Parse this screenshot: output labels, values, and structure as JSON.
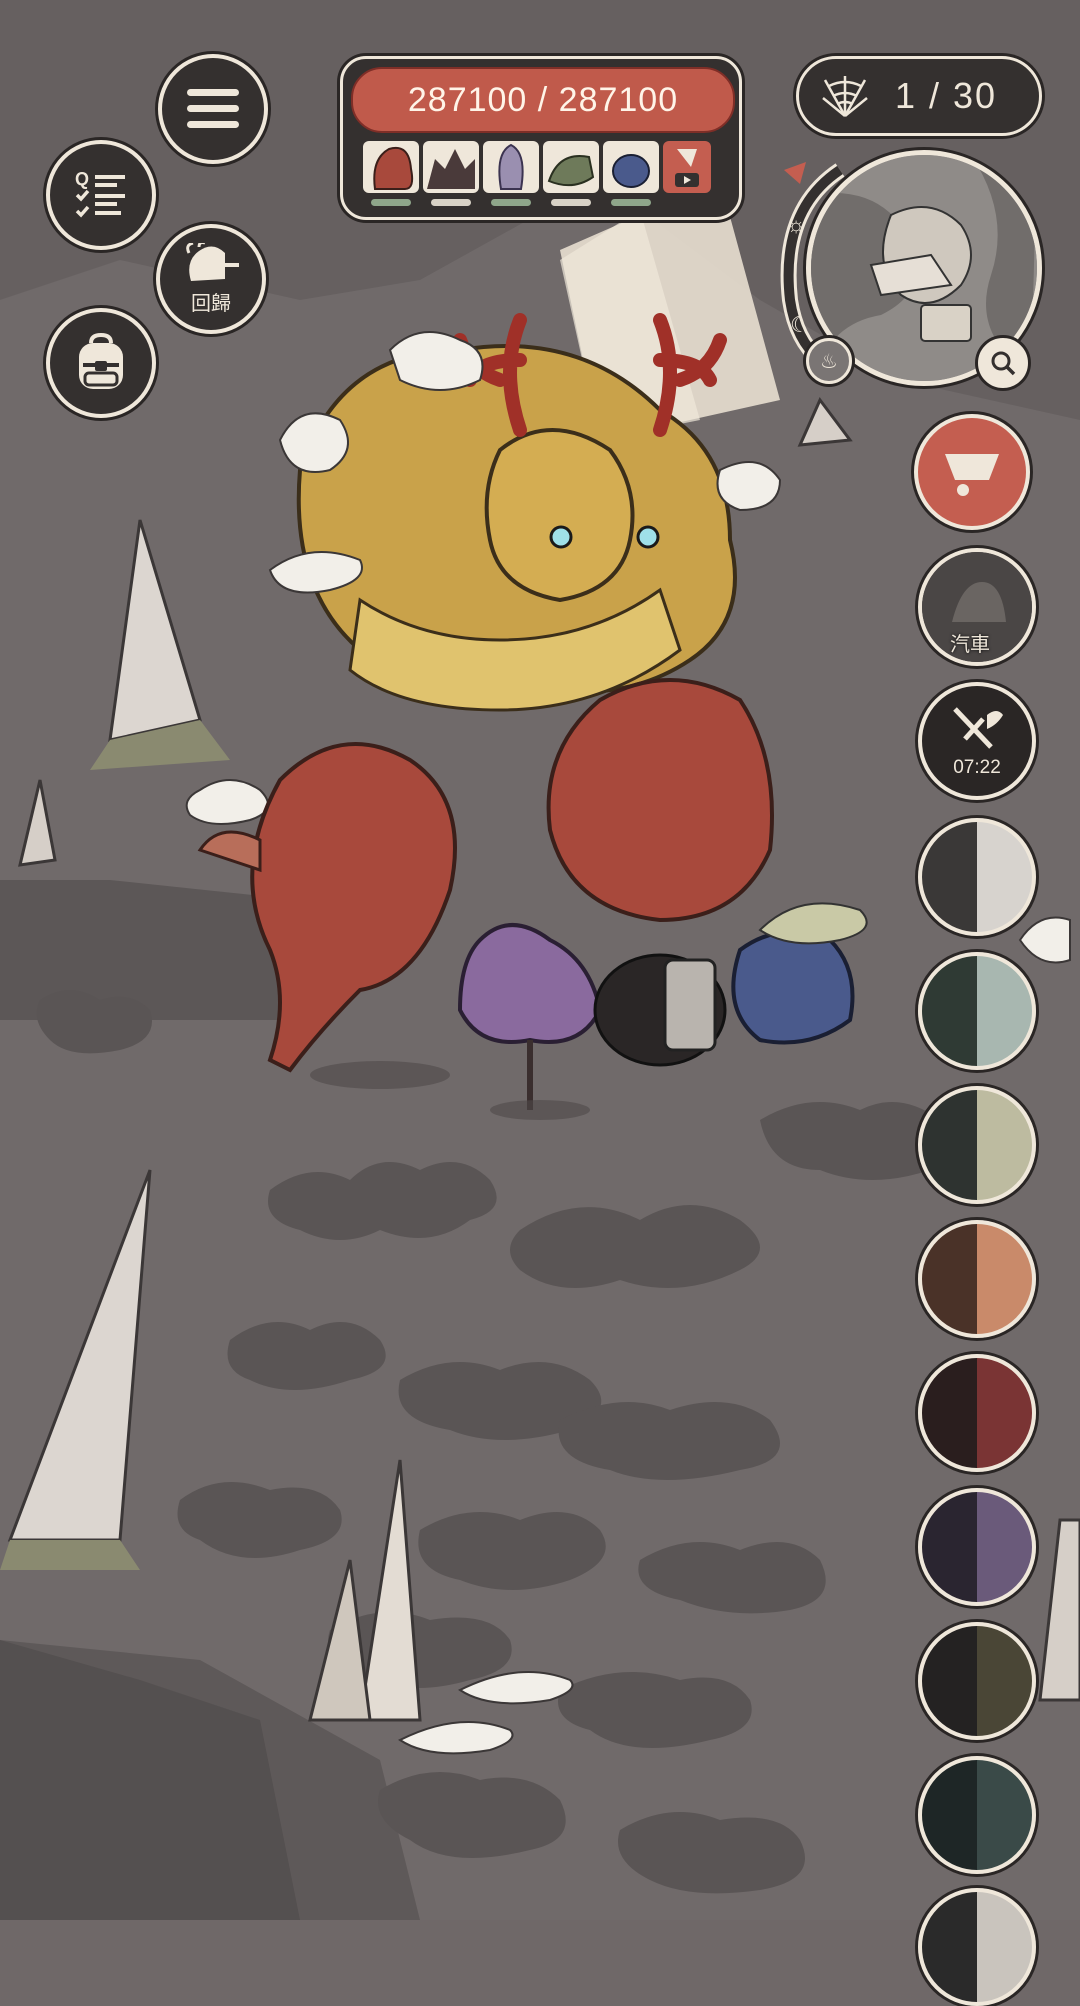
{
  "top_left": {
    "menu_icon": "hamburger-icon",
    "quest_icon": "quest-checklist-icon",
    "return_label": "回歸",
    "return_icon": "return-icon",
    "bag_icon": "backpack-icon"
  },
  "hp": {
    "label": "287100 / 287100",
    "current": 287100,
    "max": 287100
  },
  "party": [
    {
      "name": "red-dragon",
      "hp_fraction": 1.0
    },
    {
      "name": "dark-beast",
      "hp_fraction": 1.0
    },
    {
      "name": "pale-squid",
      "hp_fraction": 1.0
    },
    {
      "name": "green-lizard",
      "hp_fraction": 1.0
    },
    {
      "name": "blue-spider",
      "hp_fraction": 1.0
    }
  ],
  "web_counter": {
    "icon": "spiderweb-icon",
    "label": "1 / 30"
  },
  "minimap": {
    "zoom_icon": "magnifier-icon",
    "flame_icon": "flame-icon",
    "sun_icon": "sun-icon",
    "moon_icon": "moon-icon"
  },
  "side_buttons": {
    "cart_icon": "cart-icon",
    "car_label": "汽車",
    "battle_timer": "07:22",
    "battle_icon": "crossed-swords-icon"
  },
  "colors": {
    "panel_dark": "#34302f",
    "panel_border": "#efe7da",
    "hp_red": "#c05a4b",
    "party_hp_green": "#8fa68a",
    "cart_red": "#c45e50"
  }
}
